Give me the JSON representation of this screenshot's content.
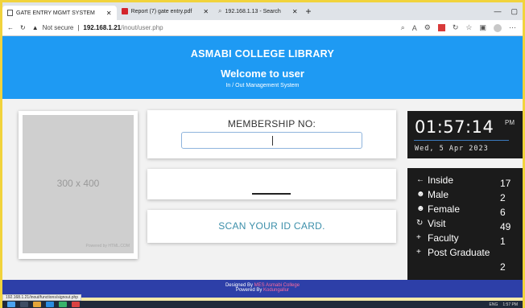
{
  "browser": {
    "tabs": [
      {
        "title": "GATE ENTRY MGMT SYSTEM",
        "active": true
      },
      {
        "title": "Report (7) gate entry.pdf",
        "active": false
      },
      {
        "title": "192.168.1.13 - Search",
        "active": false
      }
    ],
    "new_tab": "+",
    "address": {
      "security": "Not secure",
      "host": "192.168.1.21",
      "path": "/inout/user.php"
    },
    "status_url": "192.168.1.21/inout/functions/signout.php"
  },
  "header": {
    "college": "ASMABI COLLEGE LIBRARY",
    "welcome": "Welcome to user",
    "subtitle": "In / Out Management System"
  },
  "photo": {
    "placeholder": "300 x 400",
    "powered": "Powered by HTML.COM"
  },
  "membership": {
    "label": "MEMBERSHIP NO:",
    "value": ""
  },
  "scan_message": "SCAN YOUR ID CARD.",
  "clock": {
    "time": "01:57:14",
    "ampm": "PM",
    "date": "Wed, 5 Apr 2023"
  },
  "stats": [
    {
      "icon": "←",
      "label": "Inside",
      "value": "17"
    },
    {
      "icon": "☻",
      "label": "Male",
      "value": "2"
    },
    {
      "icon": "☻",
      "label": "Female",
      "value": "6"
    },
    {
      "icon": "↻",
      "label": "Visit",
      "value": "49"
    },
    {
      "icon": "+",
      "label": "Faculty",
      "value": "1"
    },
    {
      "icon": "+",
      "label": "Post Graduate",
      "value": "2"
    }
  ],
  "footer": {
    "designed_prefix": "Designed By",
    "designed_by": "MES Asmabi College",
    "powered_prefix": "Powered By",
    "powered_by": "Kodungallur"
  },
  "taskbar": {
    "lang": "ENG",
    "time": "1:57 PM"
  },
  "colors": {
    "header": "#1e9af3",
    "footer": "#2d3fa8",
    "panel": "#1b1b1b",
    "frame": "#f1d33c"
  }
}
